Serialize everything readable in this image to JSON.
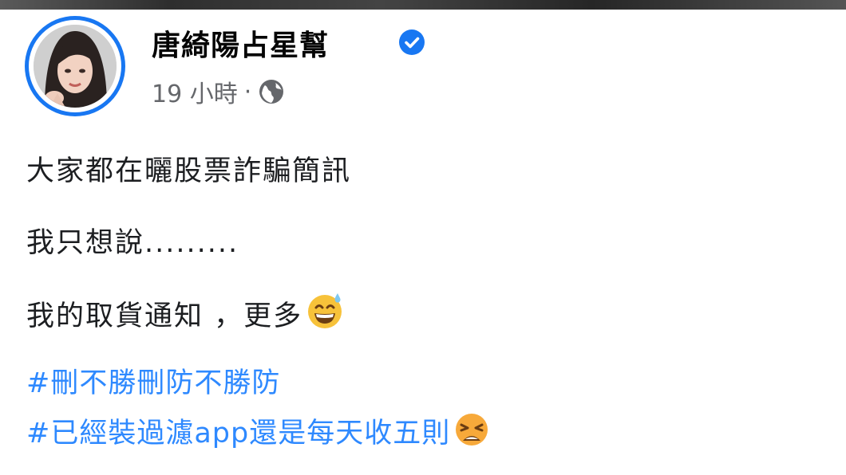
{
  "post": {
    "author": "唐綺陽占星幫",
    "verified": true,
    "timestamp": "19 小時",
    "separator": "·",
    "audience_icon": "globe-icon",
    "body_lines": [
      "大家都在曬股票詐騙簡訊",
      "我只想說.........",
      "我的取貨通知 ，更多"
    ],
    "line3_emoji": "grinning-face-with-sweat-icon",
    "hashtags": [
      "#刪不勝刪防不勝防",
      "#已經裝過濾app還是每天收五則"
    ],
    "hashtag2_emoji": "weary-face-icon"
  },
  "colors": {
    "accent": "#1877f2",
    "hashtag": "#2e89ff",
    "meta": "#65676b",
    "text": "#1c1e21"
  }
}
